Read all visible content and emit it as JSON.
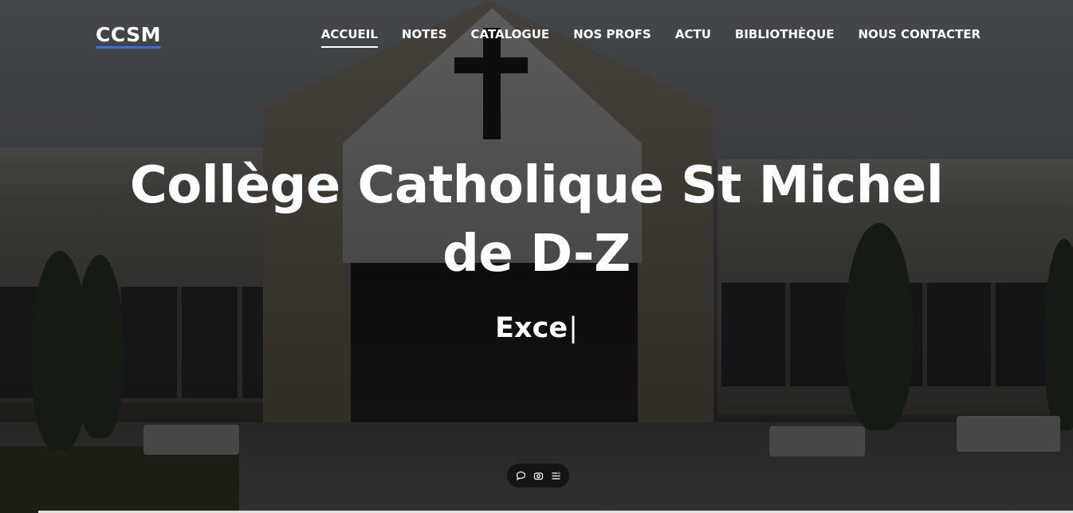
{
  "navbar": {
    "logo": "CCSM",
    "items": [
      {
        "label": "ACCUEIL",
        "active": true
      },
      {
        "label": "NOTES"
      },
      {
        "label": "CATALOGUE"
      },
      {
        "label": "NOS PROFS"
      },
      {
        "label": "ACTU"
      },
      {
        "label": "BIBLIOTHÈQUE"
      },
      {
        "label": "NOUS CONTACTER"
      }
    ]
  },
  "hero": {
    "title": "Collège Catholique St Michel de D-Z",
    "typed_text": "Exce",
    "caret": "|"
  },
  "toolbar": {
    "icons": [
      "chat-icon",
      "camera-icon",
      "list-settings-icon"
    ]
  },
  "colors": {
    "accent": "#3b6fd6",
    "text": "#ffffff",
    "toolbar_bg": "#141414"
  }
}
